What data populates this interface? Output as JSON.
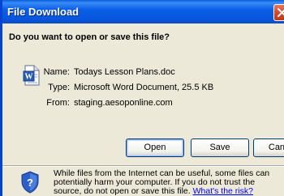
{
  "window": {
    "title": "File Download",
    "close_icon": "close-icon"
  },
  "prompt": {
    "question": "Do you want to open or save this file?"
  },
  "file": {
    "icon": "word-document-icon",
    "name_label": "Name:",
    "name_value": "Todays Lesson Plans.doc",
    "type_label": "Type:",
    "type_value": "Microsoft Word Document, 25.5 KB",
    "from_label": "From:",
    "from_value": "staging.aesoponline.com"
  },
  "buttons": {
    "open_label": "Open",
    "save_label": "Save",
    "cancel_label": "Cancel"
  },
  "warning": {
    "icon": "shield-question-icon",
    "text": "While files from the Internet can be useful, some files can potentially harm your computer. If you do not trust the source, do not open or save this file.",
    "link_text": "What's the risk?"
  },
  "colors": {
    "titlebar": "#0a5ddc",
    "dialog_bg": "#ece9d8",
    "close_button": "#d54a2a",
    "link": "#0000ff"
  }
}
